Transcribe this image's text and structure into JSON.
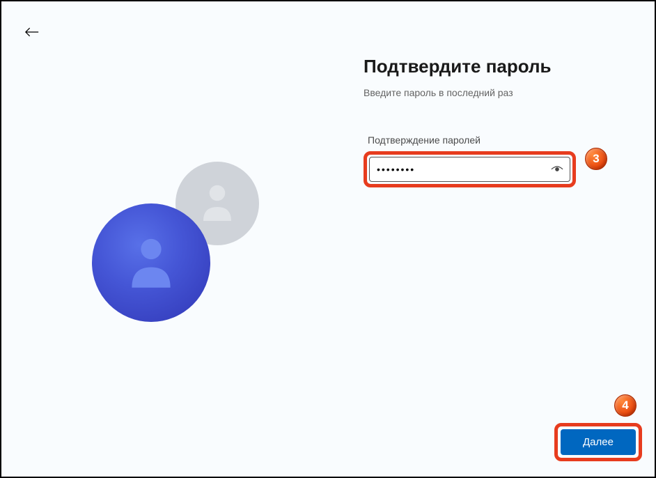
{
  "title": "Подтвердите пароль",
  "subtitle": "Введите пароль в последний раз",
  "password": {
    "label": "Подтверждение паролей",
    "value": "••••••••"
  },
  "nextButton": "Далее",
  "badges": {
    "step3": "3",
    "step4": "4"
  }
}
